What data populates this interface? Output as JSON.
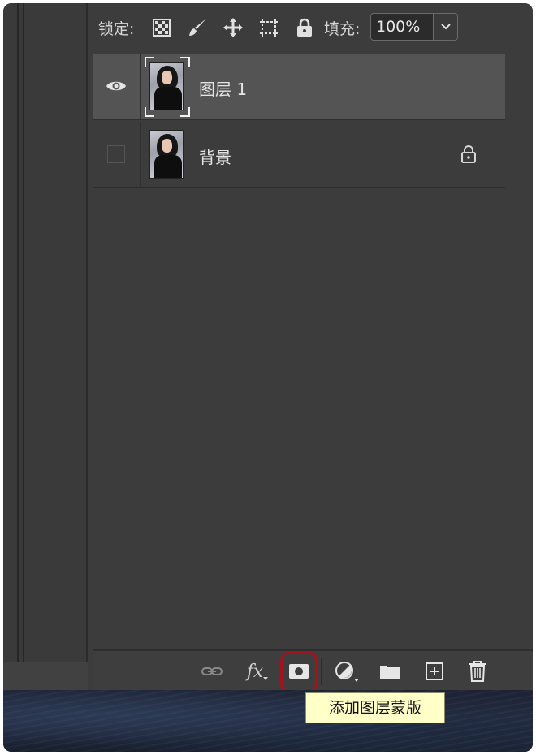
{
  "lock_bar": {
    "label": "锁定:",
    "icons": [
      "lock-transparent-pixels-icon",
      "lock-image-pixels-icon",
      "lock-position-icon",
      "lock-artboard-icon",
      "lock-all-icon"
    ],
    "fill_label": "填充:",
    "fill_value": "100%"
  },
  "layers": [
    {
      "name": "图层 1",
      "visible": true,
      "selected": true,
      "locked": false
    },
    {
      "name": "背景",
      "visible": false,
      "selected": false,
      "locked": true
    }
  ],
  "footer": {
    "buttons": [
      "link-layers-icon",
      "fx-icon",
      "add-mask-icon",
      "adjustment-layer-icon",
      "group-folder-icon",
      "new-layer-icon",
      "delete-layer-icon"
    ],
    "fx_label": "fx",
    "highlighted": "add-mask-icon"
  },
  "tooltip": {
    "text": "添加图层蒙版"
  },
  "colors": {
    "panel_bg": "#3c3c3c",
    "selected_row": "#545454",
    "highlight_ring": "#a6121b",
    "tooltip_bg": "#ffffc8"
  }
}
